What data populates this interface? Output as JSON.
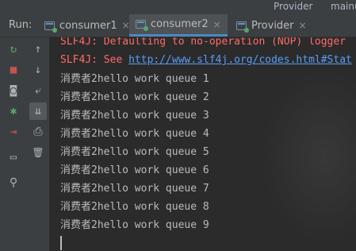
{
  "top": {
    "provider": "Provider",
    "main": "main("
  },
  "run": {
    "label": "Run:",
    "tabs": [
      {
        "label": "consumer1",
        "close": "×"
      },
      {
        "label": "consumer2",
        "close": "×"
      },
      {
        "label": "Provider",
        "close": "×"
      }
    ]
  },
  "console": {
    "err1": "SLF4J: Defaulting to no-operation (NOP) logger",
    "err2_prefix": "SLF4J: See ",
    "err2_link": "http://www.slf4j.org/codes.html#Stat",
    "lines": [
      "消费者2hello work queue 1",
      "消费者2hello work queue 2",
      "消费者2hello work queue 3",
      "消费者2hello work queue 4",
      "消费者2hello work queue 5",
      "消费者2hello work queue 6",
      "消费者2hello work queue 7",
      "消费者2hello work queue 8",
      "消费者2hello work queue 9"
    ]
  },
  "icons": {
    "rerun": "↻",
    "stop": "■",
    "camera": "◙",
    "debug": "✱",
    "exit": "⇥",
    "layout": "▭",
    "pin": "⚲",
    "up": "↑",
    "down": "↓",
    "wrap": "⤶",
    "scroll_end": "⇊",
    "print": "⎙",
    "trash": "🗑"
  },
  "colors": {
    "background": "#2b2b2b",
    "panel": "#3c3f41",
    "text": "#bbbbbb",
    "error": "#ff6b68",
    "link": "#589df6",
    "active_tab_underline": "#4a88c7",
    "run_green": "#59a869",
    "stop_red": "#c75450"
  }
}
